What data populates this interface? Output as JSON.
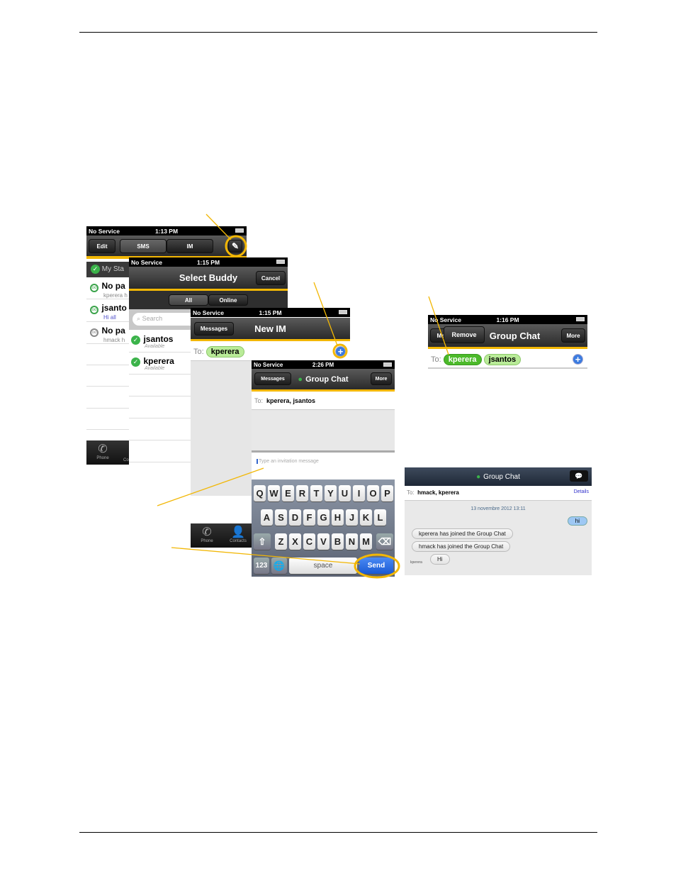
{
  "accent": "#f2b705",
  "s1": {
    "status": {
      "carrier": "No Service",
      "time": "1:13 PM"
    },
    "edit": "Edit",
    "tabs": [
      "SMS",
      "IM"
    ],
    "my_status": "My Sta",
    "rows": [
      {
        "name": "No pa",
        "sub": "kperera h"
      },
      {
        "name": "jsanto",
        "sub": "Hi all"
      },
      {
        "name": "No pa",
        "sub": "hmack h"
      }
    ],
    "tab_phone": "Phone",
    "tab_contacts": "Co"
  },
  "s2": {
    "status": {
      "carrier": "No Service",
      "time": "1:15 PM"
    },
    "title": "Select Buddy",
    "cancel": "Cancel",
    "seg": [
      "All",
      "Online"
    ],
    "search_placeholder": "Search",
    "rows": [
      {
        "name": "jsantos",
        "sub": "Available"
      },
      {
        "name": "kperera",
        "sub": "Available"
      }
    ]
  },
  "s3": {
    "status": {
      "carrier": "No Service",
      "time": "1:15 PM"
    },
    "back": "Messages",
    "title": "New IM",
    "to_label": "To:",
    "to_pill": "kperera",
    "tab_phone": "Phone",
    "tab_contacts": "Contacts"
  },
  "s4": {
    "status": {
      "carrier": "No Service",
      "time": "2:26 PM"
    },
    "back": "Messages",
    "title": "Group Chat",
    "more": "More",
    "to_label": "To:",
    "to_value": "kperera, jsantos",
    "input_placeholder": "Type an invitation message",
    "keys_row1": [
      "Q",
      "W",
      "E",
      "R",
      "T",
      "Y",
      "U",
      "I",
      "O",
      "P"
    ],
    "keys_row2": [
      "A",
      "S",
      "D",
      "F",
      "G",
      "H",
      "J",
      "K",
      "L"
    ],
    "keys_row3": [
      "Z",
      "X",
      "C",
      "V",
      "B",
      "N",
      "M"
    ],
    "key_123": "123",
    "key_space": "space",
    "key_send": "Send"
  },
  "s5": {
    "status": {
      "carrier": "No Service",
      "time": "1:16 PM"
    },
    "back": "Me",
    "remove": "Remove",
    "title": "Group Chat",
    "more": "More",
    "to_label": "To:",
    "pills": [
      "kperera",
      "jsantos"
    ]
  },
  "s6": {
    "title": "Group Chat",
    "to_label": "To:",
    "to_value": "hmack, kperera",
    "details": "Details",
    "date": "13 novembre 2012 13:11",
    "msg_out": "hi",
    "sys1": "kperera has joined the Group Chat",
    "sys2": "hmack has joined the Group Chat",
    "sender": "kperera",
    "msg_in": "Hi"
  }
}
